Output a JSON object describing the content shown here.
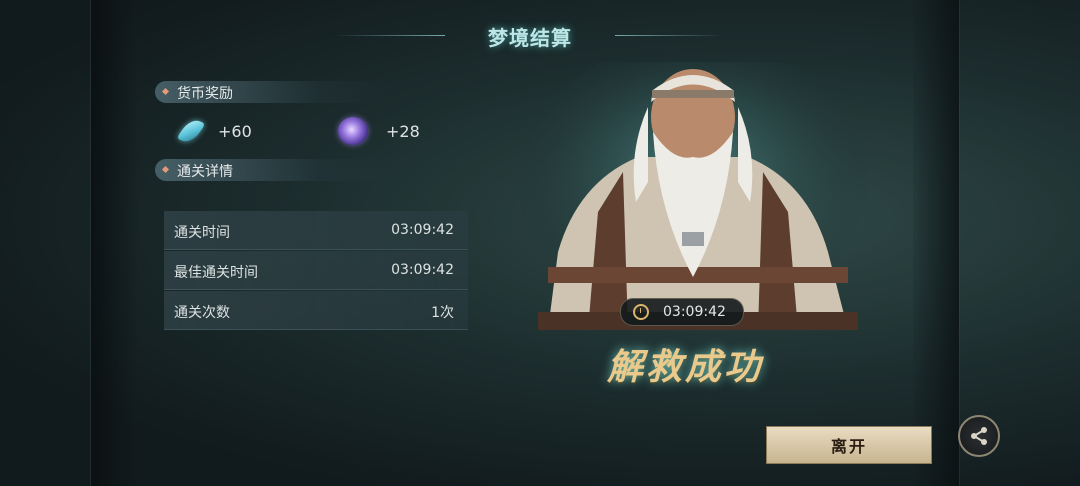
{
  "title": "梦境结算",
  "currency_section": {
    "label": "货币奖励"
  },
  "rewards": [
    {
      "icon": "crystal-icon",
      "amount": "+60"
    },
    {
      "icon": "dream-orb-icon",
      "amount": "+28"
    }
  ],
  "details_section": {
    "label": "通关详情"
  },
  "details": [
    {
      "label": "通关时间",
      "value": "03:09:42"
    },
    {
      "label": "最佳通关时间",
      "value": "03:09:42"
    },
    {
      "label": "通关次数",
      "value": "1次"
    }
  ],
  "portrait": {
    "time": "03:09:42"
  },
  "result_text": "解救成功",
  "buttons": {
    "leave": "离开",
    "share_icon": "share-icon"
  },
  "colors": {
    "accent": "#bfe6e6",
    "gold": "#e9c98c",
    "button": "#e9dcc2"
  }
}
